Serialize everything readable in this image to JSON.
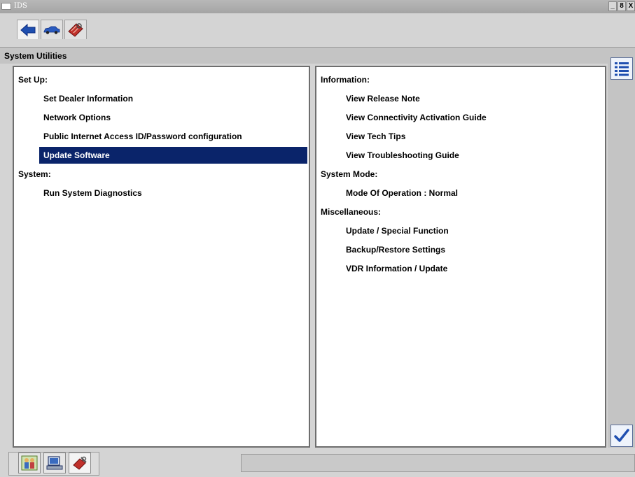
{
  "window": {
    "title": "IDS",
    "controls": [
      "_",
      "8",
      "X"
    ]
  },
  "toolbar": {
    "buttons": [
      {
        "icon": "back-arrow-icon"
      },
      {
        "icon": "vehicle-icon"
      },
      {
        "icon": "toolbox-icon"
      }
    ]
  },
  "header": {
    "title": "System Utilities"
  },
  "left_panel": {
    "sections": [
      {
        "label": "Set Up:",
        "items": [
          "Set Dealer Information",
          "Network Options",
          "Public Internet Access ID/Password configuration",
          "Update Software"
        ]
      },
      {
        "label": "System:",
        "items": [
          "Run System Diagnostics"
        ]
      }
    ],
    "selected_item": "Update Software"
  },
  "right_panel": {
    "sections": [
      {
        "label": "Information:",
        "items": [
          "View Release Note",
          "View Connectivity Activation Guide",
          "View Tech Tips",
          "View Troubleshooting Guide"
        ]
      },
      {
        "label": "System Mode:",
        "items": [
          "Mode Of Operation : Normal"
        ]
      },
      {
        "label": "Miscellaneous:",
        "items": [
          "Update / Special Function",
          "Backup/Restore Settings",
          "VDR Information / Update"
        ]
      }
    ]
  },
  "side": {
    "buttons": [
      {
        "icon": "list-icon"
      },
      {
        "icon": "checkmark-icon"
      }
    ]
  },
  "bottom": {
    "tabs": [
      {
        "icon": "people-icon"
      },
      {
        "icon": "computer-icon"
      },
      {
        "icon": "tools-icon"
      }
    ],
    "status_text": ""
  },
  "colors": {
    "selection": "#0a246a",
    "accent_blue": "#1f4fb0",
    "toolbox_red": "#c0302a"
  }
}
